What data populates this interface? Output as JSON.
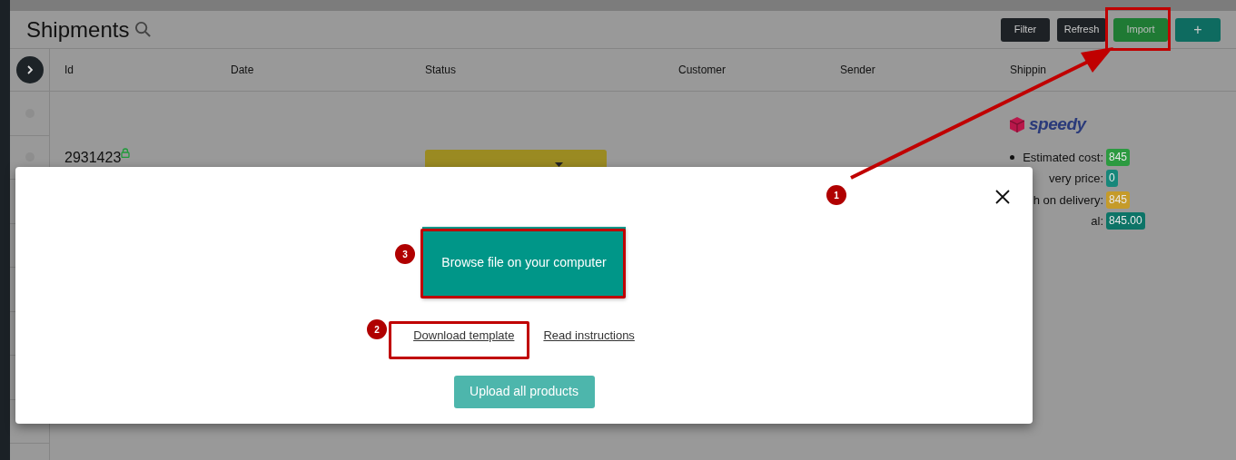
{
  "page": {
    "title": "Shipments",
    "toolbar": [
      {
        "label": "Filter",
        "kind": "dark"
      },
      {
        "label": "Refresh",
        "kind": "dark"
      },
      {
        "label": "Import",
        "kind": "green"
      },
      {
        "label": "+",
        "kind": "teal"
      }
    ]
  },
  "table": {
    "columns": [
      "Id",
      "Date",
      "Status",
      "Customer",
      "Sender",
      "Shippin"
    ],
    "selectors": [
      {
        "checked": false
      },
      {
        "checked": false
      }
    ],
    "row": {
      "id": "2931423",
      "courier": "speedy",
      "costs": [
        {
          "label": "Estimated cost:",
          "value": "845",
          "color": "#2c9a40"
        },
        {
          "label": "very price:",
          "value": "0",
          "color": "#17877a"
        },
        {
          "label": "h on delivery:",
          "value": "845",
          "color": "#c59b2a"
        },
        {
          "label": "al:",
          "value": "845.00",
          "color": "#0d7467"
        }
      ]
    }
  },
  "dialog": {
    "browse_button": "Browse file on your computer",
    "links": [
      "Download template",
      "Read instructions"
    ],
    "upload_button": "Upload all products"
  },
  "annotations": [
    {
      "number": "1"
    },
    {
      "number": "2"
    },
    {
      "number": "3"
    }
  ]
}
